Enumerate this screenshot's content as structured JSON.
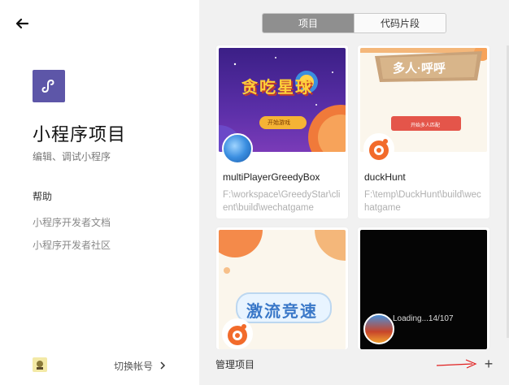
{
  "sidebar": {
    "title": "小程序项目",
    "subtitle": "编辑、调试小程序",
    "help_title": "帮助",
    "help_links": [
      "小程序开发者文档",
      "小程序开发者社区"
    ],
    "switch_account": "切换帐号"
  },
  "tabs": [
    {
      "label": "项目",
      "active": true
    },
    {
      "label": "代码片段",
      "active": false
    }
  ],
  "projects": [
    {
      "name": "multiPlayerGreedyBox",
      "path": "F:\\workspace\\GreedyStar\\client\\build\\wechatgame",
      "thumb_text": "贪吃星球",
      "thumb_button": "开始游戏"
    },
    {
      "name": "duckHunt",
      "path": "F:\\temp\\DuckHunt\\build\\wechatgame",
      "thumb_text": "多人·呼呼",
      "thumb_button": "开始多人匹配"
    },
    {
      "name": "",
      "path": "",
      "thumb_text": "激流竞速"
    },
    {
      "name": "",
      "path": "",
      "thumb_text": "Loading...14/107"
    }
  ],
  "bottom": {
    "manage_label": "管理项目",
    "add_symbol": "+"
  },
  "colors": {
    "logo": "#5d56a8",
    "active_tab": "#8f8f8f",
    "annotation_arrow": "#e02020"
  }
}
